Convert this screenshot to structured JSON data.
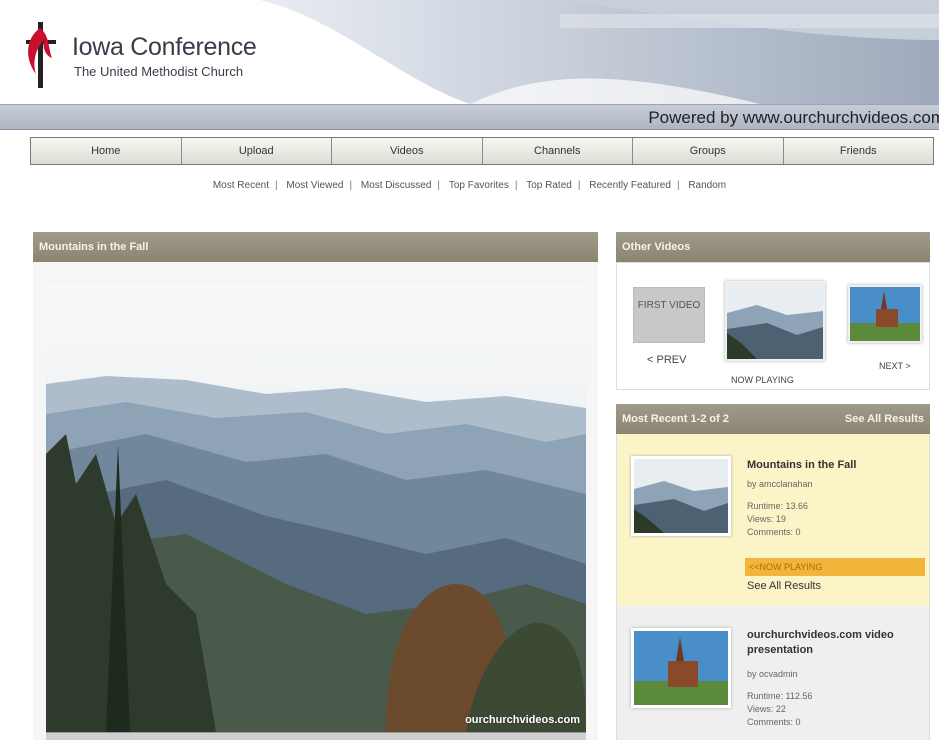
{
  "header": {
    "title": "Iowa Conference",
    "subtitle": "The United Methodist Church",
    "powered_by": "Powered by www.ourchurchvideos.com"
  },
  "nav": {
    "items": [
      "Home",
      "Upload",
      "Videos",
      "Channels",
      "Groups",
      "Friends"
    ]
  },
  "subnav": {
    "items": [
      "Most Recent",
      "Most Viewed",
      "Most Discussed",
      "Top Favorites",
      "Top Rated",
      "Recently Featured",
      "Random"
    ]
  },
  "video": {
    "title": "Mountains in the Fall",
    "watermark": "ourchurchvideos.com"
  },
  "other_videos": {
    "heading": "Other Videos",
    "first_video": "FIRST VIDEO",
    "prev_label": "< PREV",
    "now_playing_label": "NOW PLAYING",
    "next_label": "NEXT >"
  },
  "most_recent": {
    "heading": "Most Recent 1-2 of 2",
    "see_all": "See All Results",
    "items": [
      {
        "title": "Mountains in the Fall",
        "by": "by amcclanahan",
        "runtime": "Runtime: 13.66",
        "views": "Views: 19",
        "comments": "Comments: 0",
        "status": "<<NOW PLAYING",
        "see_all": "See All Results"
      },
      {
        "title": "ourchurchvideos.com video presentation",
        "by": "by ocvadmin",
        "runtime": "Runtime: 112.56",
        "views": "Views: 22",
        "comments": "Comments: 0"
      }
    ]
  },
  "colors": {
    "panel_header": "#8f8a78",
    "highlight_row": "#fbf4c6",
    "now_playing": "#f2b53c",
    "logo_red": "#c8102e"
  }
}
